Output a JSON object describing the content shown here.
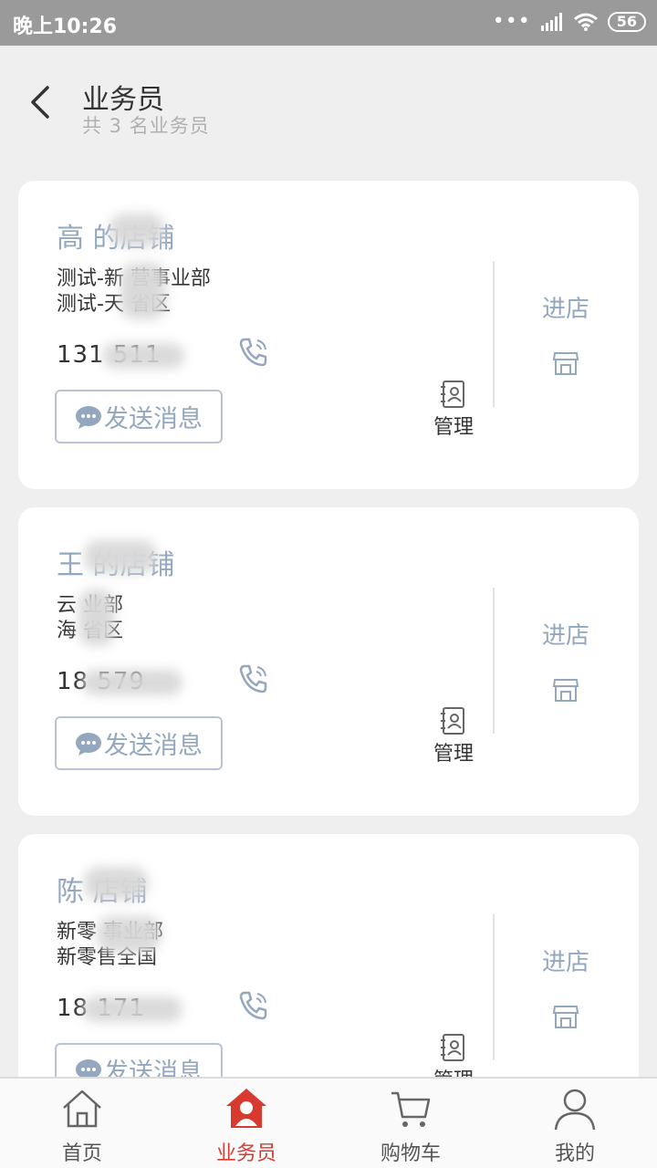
{
  "status_bar": {
    "time": "晚上10:26",
    "battery": "56"
  },
  "header": {
    "title": "业务员",
    "subtitle": "共 3 名业务员"
  },
  "cards": [
    {
      "store_name": "高      的店铺",
      "dept_line1": "测试-新    营事业部",
      "dept_line2": "测试-天    省区",
      "phone": "131          511",
      "message_label": "发送消息",
      "manage_label": "管理",
      "enter_label": "进店"
    },
    {
      "store_name": "王      的店铺",
      "dept_line1": "云    业部",
      "dept_line2": "海    省区",
      "phone": "18            579",
      "message_label": "发送消息",
      "manage_label": "管理",
      "enter_label": "进店"
    },
    {
      "store_name": "陈      店铺",
      "dept_line1": "新零    事业部",
      "dept_line2": "新零售全国",
      "phone": "18            171",
      "message_label": "发送消息",
      "manage_label": "管理",
      "enter_label": "进店"
    }
  ],
  "tabs": [
    {
      "label": "首页",
      "icon": "home-icon"
    },
    {
      "label": "业务员",
      "icon": "salesman-icon",
      "active": true
    },
    {
      "label": "购物车",
      "icon": "cart-icon"
    },
    {
      "label": "我的",
      "icon": "profile-icon"
    }
  ],
  "colors": {
    "accent_red": "#d93a2f",
    "link_blue": "#93a7bf",
    "status_bar": "#9a9a9a"
  }
}
